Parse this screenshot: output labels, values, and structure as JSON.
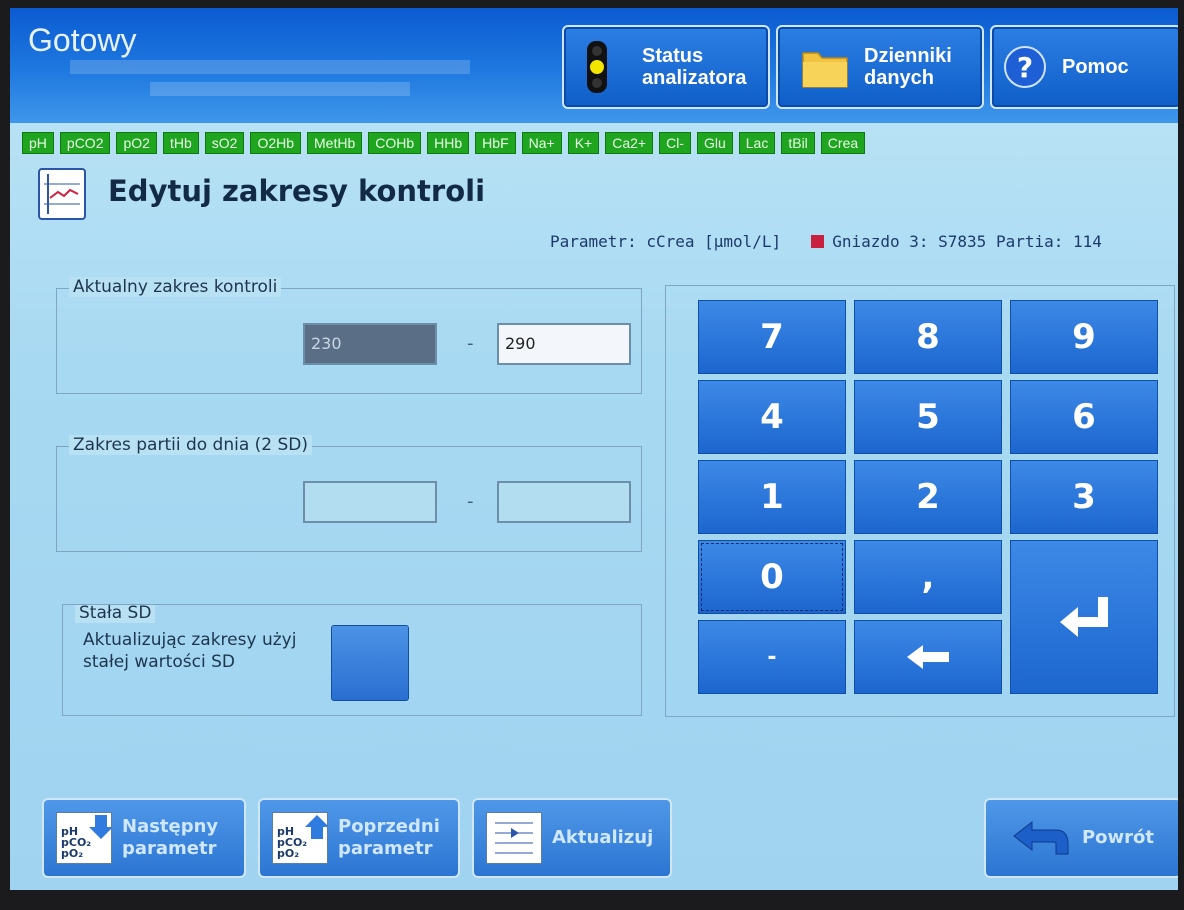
{
  "header": {
    "status": "Gotowy",
    "buttons": {
      "status_label": "Status\nanalizatora",
      "logs_label": "Dzienniki\ndanych",
      "help_label": "Pomoc"
    }
  },
  "param_chips": [
    "pH",
    "pCO2",
    "pO2",
    "tHb",
    "sO2",
    "O2Hb",
    "MetHb",
    "COHb",
    "HHb",
    "HbF",
    "Na+",
    "K+",
    "Ca2+",
    "Cl-",
    "Glu",
    "Lac",
    "tBil",
    "Crea"
  ],
  "page": {
    "title": "Edytuj zakresy kontroli",
    "param_line": "Parametr:  cCrea [µmol/L]",
    "slot_line": "Gniazdo 3: S7835 Partia: 114"
  },
  "current_range": {
    "label": "Aktualny zakres kontroli",
    "low": "230",
    "high": "290",
    "dash": "-"
  },
  "lot_range": {
    "label": "Zakres partii do dnia (2 SD)",
    "low": "",
    "high": "",
    "dash": "-"
  },
  "fixed_sd": {
    "label": "Stała SD",
    "text": "Aktualizując zakresy użyj stałej wartości SD"
  },
  "keypad": {
    "k7": "7",
    "k8": "8",
    "k9": "9",
    "k4": "4",
    "k5": "5",
    "k6": "6",
    "k1": "1",
    "k2": "2",
    "k3": "3",
    "k0": "0",
    "comma": ",",
    "minus": "-"
  },
  "bottom": {
    "next_label": "Następny\nparametr",
    "prev_label": "Poprzedni\nparametr",
    "update_label": "Aktualizuj",
    "back_label": "Powrót"
  },
  "colors": {
    "chip_green": "#1fa51f",
    "slot_marker": "#c9203f",
    "header_blue": "#0b5bd0"
  }
}
